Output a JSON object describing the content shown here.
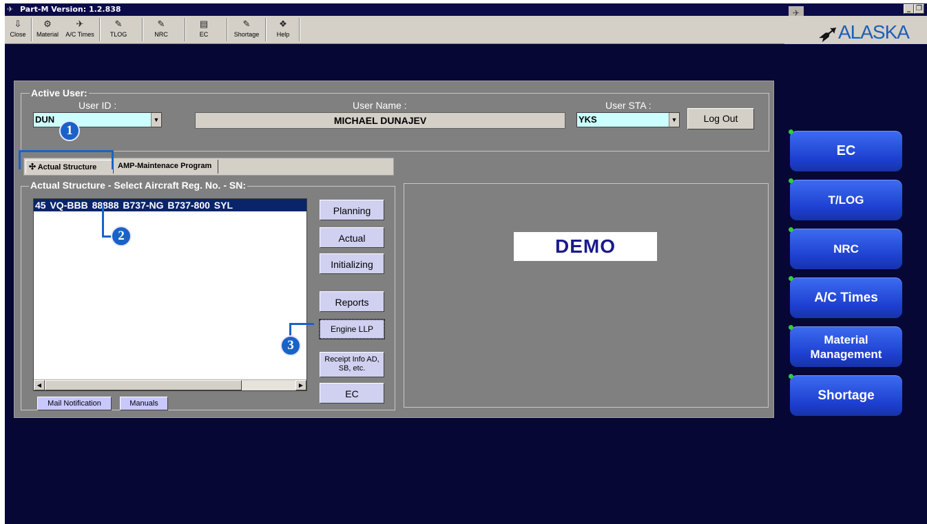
{
  "window": {
    "title": "Part-M  Version: 1.2.838",
    "logo_text": "ALASKA"
  },
  "toolbar": {
    "items": [
      {
        "label": "Close",
        "icon": "exit-door-icon"
      },
      {
        "label": "Material",
        "icon": "material-icon"
      },
      {
        "label": "A/C Times",
        "icon": "airplane-icon"
      },
      {
        "label": "TLOG",
        "icon": "tlog-icon"
      },
      {
        "label": "NRC",
        "icon": "nrc-icon"
      },
      {
        "label": "EC",
        "icon": "ec-icon"
      },
      {
        "label": "Shortage",
        "icon": "shortage-icon"
      },
      {
        "label": "Help",
        "icon": "help-book-icon"
      }
    ]
  },
  "active_user": {
    "group_label": "Active User:",
    "user_id_label": "User ID :",
    "user_id_value": "DUN",
    "user_name_label": "User Name :",
    "user_name_value": "MICHAEL DUNAJEV",
    "user_sta_label": "User STA :",
    "user_sta_value": "YKS",
    "logout_label": "Log Out"
  },
  "tabs": [
    {
      "label": "Actual Structure",
      "active": true
    },
    {
      "label": "AMP-Maintenace Program",
      "active": false
    }
  ],
  "structure": {
    "group_label": "Actual Structure - Select Aircraft Reg. No. - SN:",
    "rows": [
      "45  VQ-BBB   88888  B737-NG  B737-800    SYL"
    ],
    "mail_label": "Mail Notification",
    "manuals_label": "Manuals"
  },
  "side_buttons": {
    "planning": "Planning",
    "actual": "Actual",
    "initializing": "Initializing",
    "reports": "Reports",
    "engine_llp": "Engine LLP",
    "receipt_line1": "Receipt Info AD,",
    "receipt_line2": "SB, etc.",
    "ec": "EC"
  },
  "demo_label": "DEMO",
  "callouts": [
    "1",
    "2",
    "3"
  ],
  "nav_buttons": {
    "ec": "EC",
    "tlog": "T/LOG",
    "nrc": "NRC",
    "ac_times": "A/C Times",
    "material_line1": "Material",
    "material_line2": "Management",
    "shortage": "Shortage"
  },
  "colors": {
    "background": "#070736",
    "nav_button": "#2a52e0",
    "selection": "#0a246a",
    "callout": "#1a62c8"
  }
}
